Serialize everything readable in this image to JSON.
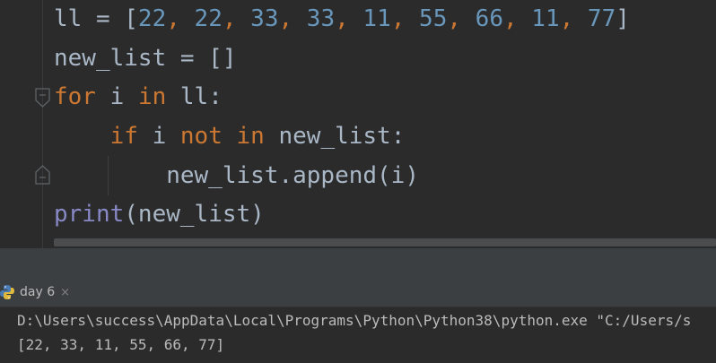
{
  "editor": {
    "lines": [
      [
        {
          "t": "ll = [",
          "c": "plain"
        },
        {
          "t": "22",
          "c": "num"
        },
        {
          "t": ", ",
          "c": "kw"
        },
        {
          "t": "22",
          "c": "num"
        },
        {
          "t": ", ",
          "c": "kw"
        },
        {
          "t": "33",
          "c": "num"
        },
        {
          "t": ", ",
          "c": "kw"
        },
        {
          "t": "33",
          "c": "num"
        },
        {
          "t": ", ",
          "c": "kw"
        },
        {
          "t": "11",
          "c": "num"
        },
        {
          "t": ", ",
          "c": "kw"
        },
        {
          "t": "55",
          "c": "num"
        },
        {
          "t": ", ",
          "c": "kw"
        },
        {
          "t": "66",
          "c": "num"
        },
        {
          "t": ", ",
          "c": "kw"
        },
        {
          "t": "11",
          "c": "num"
        },
        {
          "t": ", ",
          "c": "kw"
        },
        {
          "t": "77",
          "c": "num"
        },
        {
          "t": "]",
          "c": "plain"
        }
      ],
      [
        {
          "t": "new_list = []",
          "c": "plain"
        }
      ],
      [
        {
          "t": "for",
          "c": "kw"
        },
        {
          "t": " i ",
          "c": "plain"
        },
        {
          "t": "in",
          "c": "kw"
        },
        {
          "t": " ll:",
          "c": "plain"
        }
      ],
      [
        {
          "t": "    ",
          "c": "plain"
        },
        {
          "t": "if",
          "c": "kw"
        },
        {
          "t": " i ",
          "c": "plain"
        },
        {
          "t": "not in",
          "c": "kw"
        },
        {
          "t": " new_list:",
          "c": "plain"
        }
      ],
      [
        {
          "t": "        new_list.append(i)",
          "c": "plain"
        }
      ],
      [
        {
          "t": "print",
          "c": "bi"
        },
        {
          "t": "(new_list)",
          "c": "plain"
        }
      ]
    ]
  },
  "colors": {
    "keyword": "#cc7832",
    "number": "#6897bb",
    "builtin": "#8888c6",
    "text": "#a9b7c6"
  },
  "run_panel": {
    "tab_label": "day 6",
    "tab_icon": "python-icon",
    "close_icon": "close-icon",
    "close_glyph": "×",
    "console_lines": [
      "D:\\Users\\success\\AppData\\Local\\Programs\\Python\\Python38\\python.exe \"C:/Users/s",
      "[22, 33, 11, 55, 66, 77]"
    ]
  }
}
